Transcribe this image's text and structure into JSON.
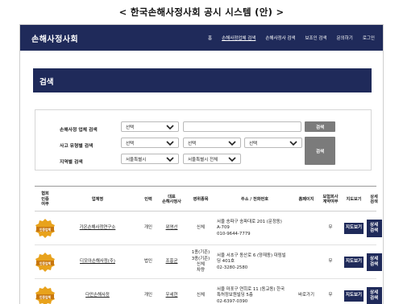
{
  "page_title": "< 한국손해사정사회 공시 시스템 (안) >",
  "header": {
    "brand": "손해사정사회",
    "nav": [
      "홈",
      "손해사정업체 검색",
      "손해사정사 검색",
      "보조인 검색",
      "문의하기",
      "로그인"
    ],
    "active_nav": 1
  },
  "hero": {
    "title": "검색"
  },
  "search": {
    "rows": [
      {
        "label": "손해사정 업체 검색",
        "select1": "선택",
        "input_value": "",
        "button": "검색"
      },
      {
        "label": "사고 유형별 검색",
        "select1": "선택",
        "select2": "선택",
        "select3": "선택"
      },
      {
        "label": "지역별 검색",
        "select1": "서울특별시",
        "select2": "서울특별시 전체"
      }
    ],
    "big_button": "검색"
  },
  "table": {
    "headers": [
      "협회\n인증\n여부",
      "업체명",
      "인력",
      "대표\n손해사정사",
      "영위종목",
      "주소 / 전화번호",
      "홈페이지",
      "보험회사\n계약여부",
      "지도보기",
      "상세\n검색"
    ],
    "badge_text": "인증업체",
    "map_button": "지도보기",
    "detail_button": "상세\n검색",
    "rows": [
      {
        "company": "가온손해사정연구소",
        "staff": "개인",
        "rep": "위영선",
        "scope": "신체",
        "address": "서울 송파구 송파대로 201 (문정동)\nA-709\n010-9644-7779",
        "homepage": "",
        "contract": "무"
      },
      {
        "company": "디모아손해사정(주)",
        "staff": "법인",
        "rep": "조홍균",
        "scope": "1종(기존)\n3종(기존)\n신체\n차량",
        "address": "서울 서초구 동산로 6 (양재동) 대림빌\n딩 401호\n02-3280-2580",
        "homepage": "",
        "contract": "무"
      },
      {
        "company": "다만손해사정",
        "staff": "개인",
        "rep": "우세현",
        "scope": "신체",
        "address": "서울 마포구 연희로 11 (동교동) 한국\n특허정보원빌딩 5층\n02-6397-0390",
        "homepage": "바로가기",
        "contract": "무"
      }
    ]
  },
  "colors": {
    "navy": "#1f2a5a",
    "gray_button": "#7b7b7b",
    "badge": "#e8a21c"
  }
}
